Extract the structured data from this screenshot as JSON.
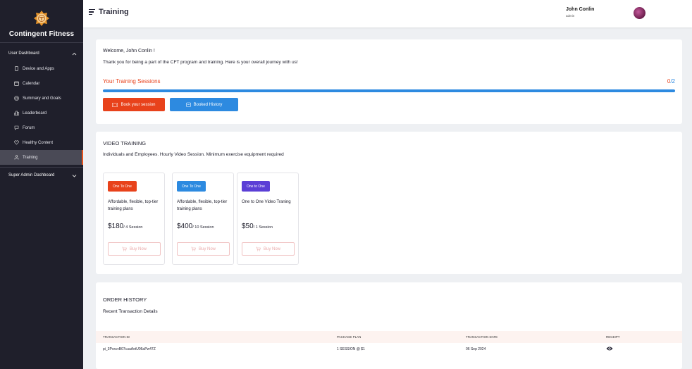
{
  "sidebar": {
    "brand": "Contingent Fitness",
    "section_user": "User Dashboard",
    "items": [
      {
        "label": "Device and Apps",
        "icon": "device-icon"
      },
      {
        "label": "Calendar",
        "icon": "calendar-icon"
      },
      {
        "label": "Summary and Goals",
        "icon": "target-icon"
      },
      {
        "label": "Leaderboard",
        "icon": "leaderboard-icon"
      },
      {
        "label": "Forum",
        "icon": "forum-icon"
      },
      {
        "label": "Healthy Content",
        "icon": "heart-icon"
      },
      {
        "label": "Training",
        "icon": "training-icon",
        "active": true
      }
    ],
    "section_admin": "Super Admin Dashboard"
  },
  "header": {
    "title": "Training",
    "user_name": "John Conlin",
    "user_role": "admin"
  },
  "journey": {
    "welcome": "Welcome, John Conlin !",
    "thanks": "Thank you for being a part of the CFT program and training. Here is your overall journey with us!",
    "sessions_label": "Your Training Sessions",
    "sessions_done": "0",
    "sessions_total": "/2",
    "book_label": "Book your session",
    "history_label": "Booked History"
  },
  "video": {
    "title": "VIDEO TRAINING",
    "subtitle": "Individuals and Employees. Hourly Video Session. Minimum exercise equipment required",
    "plans": [
      {
        "badge": "One To One",
        "desc": "Affordable, flexible, top-tier training plans",
        "price": "$180",
        "per": "/ 4 Session",
        "buy": "Buy Now"
      },
      {
        "badge": "One To One",
        "desc": "Affordable, flexible, top-tier training plans",
        "price": "$400",
        "per": "/ 10 Session",
        "buy": "Buy Now"
      },
      {
        "badge": "One to One",
        "desc": "One to One Video Traning",
        "price": "$50",
        "per": "/ 1 Session",
        "buy": "Buy Now"
      }
    ]
  },
  "orders": {
    "title": "ORDER HISTORY",
    "subtitle": "Recent Transaction Details",
    "columns": [
      "TRANSACTION ID",
      "PACKAGE PLAN",
      "TRANSACTION DATE",
      "RECEIPT"
    ],
    "rows": [
      {
        "id": "pi_3PvxcvB07cuuAetU06aPw47Z",
        "plan": "1 SESSION @ $1",
        "date": "06 Sep 2024",
        "receipt_icon": "eye-icon"
      }
    ]
  },
  "colors": {
    "accent_orange": "#e8421b",
    "accent_blue": "#2d8ae0",
    "accent_purple": "#5b3fd6",
    "sidebar_bg": "#1f1f2b"
  }
}
